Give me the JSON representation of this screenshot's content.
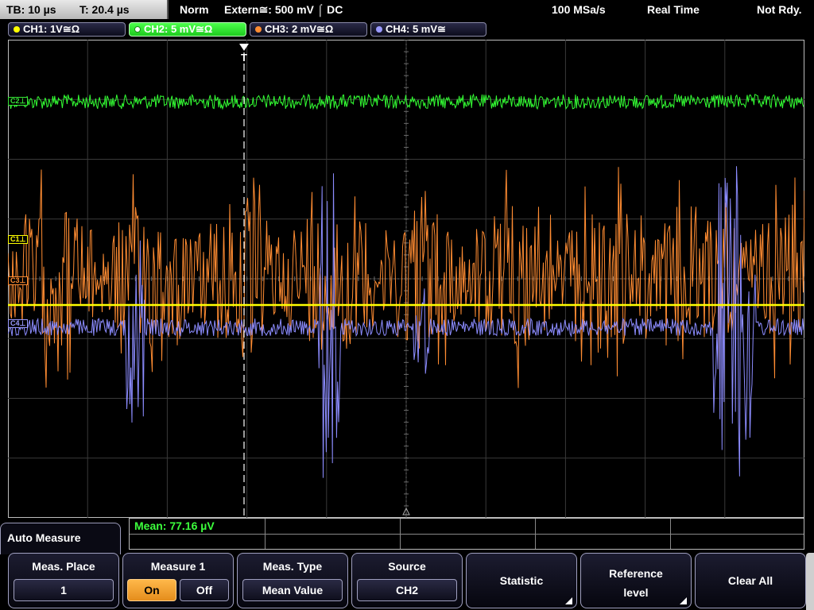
{
  "topbar": {
    "tb": "TB: 10 µs",
    "t": "T: 20.4 µs",
    "mode": "Norm",
    "trigger": "Extern≅: 500 mV ⌠ DC",
    "sample_rate": "100 MSa/s",
    "acq_mode": "Real Time",
    "status": "Not Rdy."
  },
  "channels": [
    {
      "label": "CH1: 1V≅Ω",
      "color": "#ffff00",
      "active": false,
      "marker": "C1⊥"
    },
    {
      "label": "CH2: 5 mV≅Ω",
      "color": "#36e636",
      "active": true,
      "marker": "C2⊥"
    },
    {
      "label": "CH3: 2 mV≅Ω",
      "color": "#ff8c32",
      "active": false,
      "marker": "C3⊥"
    },
    {
      "label": "CH4: 5 mV≅",
      "color": "#9a9aff",
      "active": false,
      "marker": "C4⊥"
    }
  ],
  "trigger_marker": "T",
  "measurement": {
    "mean": "Mean: 77.16 µV"
  },
  "menu": {
    "title": "Auto Measure",
    "meas_place": {
      "title": "Meas. Place",
      "value": "1"
    },
    "measure1": {
      "title": "Measure 1",
      "on": "On",
      "off": "Off"
    },
    "meas_type": {
      "title": "Meas. Type",
      "value": "Mean Value"
    },
    "source": {
      "title": "Source",
      "value": "CH2"
    },
    "statistic": {
      "label": "Statistic"
    },
    "reference": {
      "line1": "Reference",
      "line2": "level"
    },
    "clear_all": {
      "label": "Clear All"
    }
  }
}
